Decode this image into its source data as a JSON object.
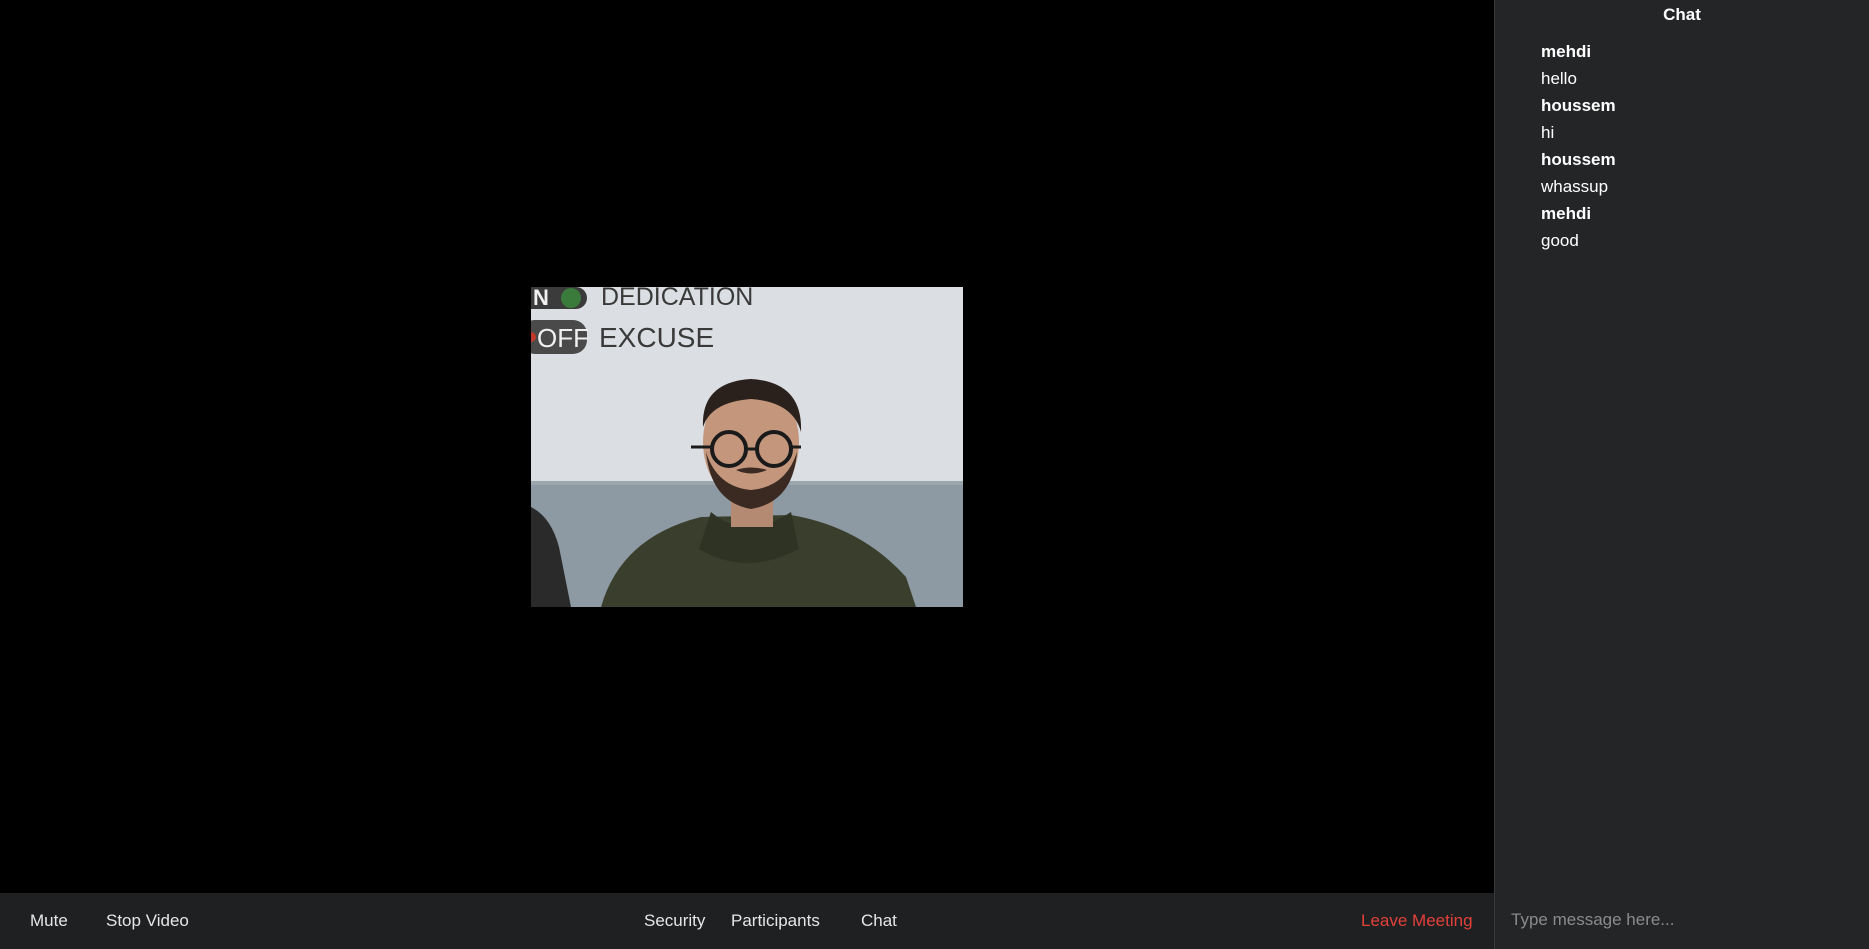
{
  "toolbar": {
    "mute_label": "Mute",
    "stop_video_label": "Stop Video",
    "security_label": "Security",
    "participants_label": "Participants",
    "chat_label": "Chat",
    "leave_label": "Leave Meeting"
  },
  "video": {
    "poster_line1": "DEDICATION",
    "poster_line2": "EXCUSE",
    "switch_on": "N",
    "switch_off": "OFF"
  },
  "chat": {
    "title": "Chat",
    "messages": [
      {
        "sender": "mehdi",
        "text": "hello"
      },
      {
        "sender": "houssem",
        "text": "hi"
      },
      {
        "sender": "houssem",
        "text": "whassup"
      },
      {
        "sender": "mehdi",
        "text": "good"
      }
    ],
    "input_placeholder": "Type message here..."
  },
  "colors": {
    "stage_bg": "#000000",
    "toolbar_bg": "#1f2022",
    "chat_bg": "#242527",
    "leave_accent": "#e3403b"
  }
}
